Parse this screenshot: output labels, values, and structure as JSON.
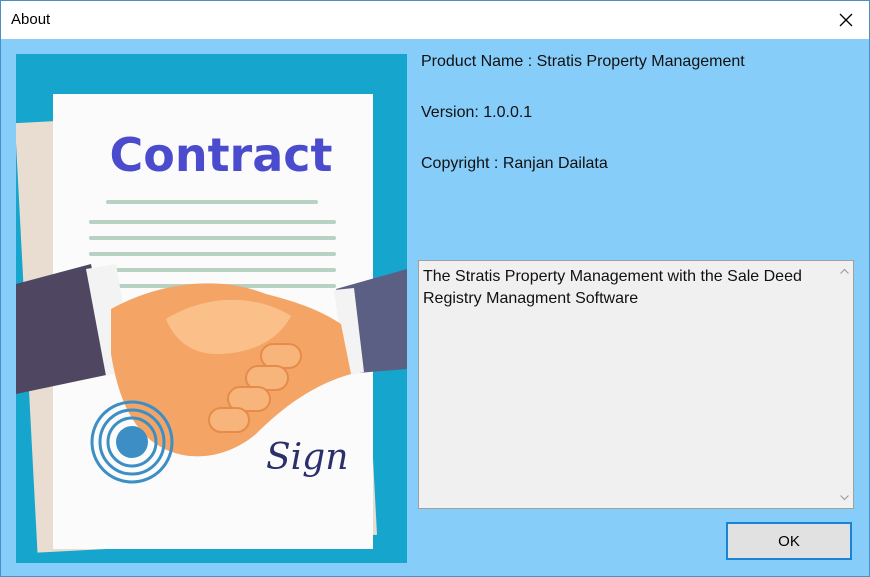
{
  "window": {
    "title": "About"
  },
  "logo": {
    "contract_text": "Contract",
    "sign_text": "Sign"
  },
  "info": {
    "product_name": "Product Name : Stratis Property Management",
    "version": "Version: 1.0.0.1",
    "copyright": "Copyright : Ranjan Dailata"
  },
  "description": {
    "text": "The Stratis Property Management with the Sale Deed Registry Managment Software"
  },
  "buttons": {
    "ok_label": "OK"
  },
  "colors": {
    "dialog_background": "#87cdfa",
    "logo_background": "#16a5cc",
    "contract_title": "#4b4ccd",
    "ok_border": "#1883d7"
  },
  "icons": {
    "close": "close-icon",
    "scroll_up": "scroll-up-arrow-icon",
    "scroll_down": "scroll-down-arrow-icon"
  }
}
